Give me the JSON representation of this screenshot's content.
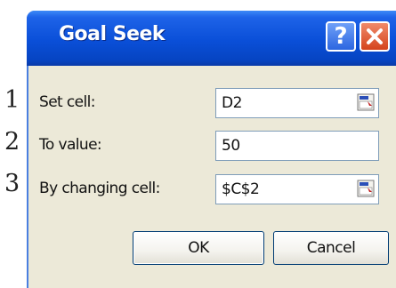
{
  "callouts": [
    "1",
    "2",
    "3"
  ],
  "dialog": {
    "title": "Goal Seek",
    "help_glyph": "?",
    "help_icon": "help-icon",
    "close_icon": "close-icon"
  },
  "fields": [
    {
      "label": "Set cell:",
      "value": "D2",
      "ref_icon": "range-select-icon"
    },
    {
      "label": "To value:",
      "value": "50"
    },
    {
      "label": "By changing cell:",
      "value": "$C$2",
      "ref_icon": "range-select-icon"
    }
  ],
  "buttons": {
    "ok_label": "OK",
    "cancel_label": "Cancel"
  },
  "colors": {
    "title_bar": "#0a4fd8",
    "close_button": "#d4431c",
    "dialog_face": "#ece9d8"
  }
}
